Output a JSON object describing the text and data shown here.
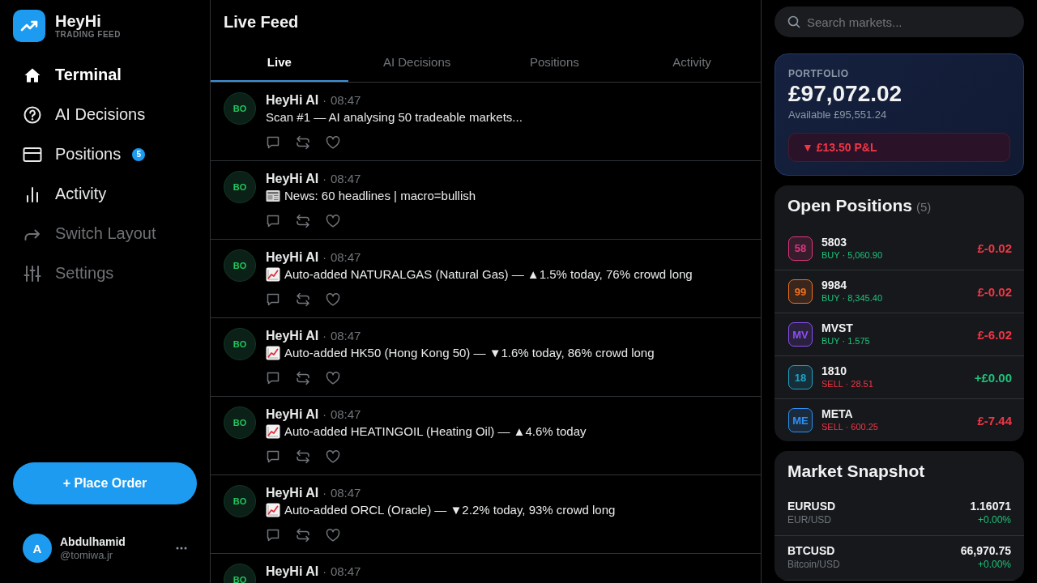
{
  "brand": {
    "name": "HeyHi",
    "tagline": "TRADING FEED"
  },
  "nav": [
    {
      "label": "Terminal",
      "selected": true,
      "disabled": false
    },
    {
      "label": "AI Decisions",
      "selected": false,
      "disabled": false
    },
    {
      "label": "Positions",
      "selected": false,
      "disabled": false,
      "badge": "5"
    },
    {
      "label": "Activity",
      "selected": false,
      "disabled": false
    },
    {
      "label": "Switch Layout",
      "selected": false,
      "disabled": true
    },
    {
      "label": "Settings",
      "selected": false,
      "disabled": true
    }
  ],
  "place_order": {
    "label": "+ Place Order"
  },
  "user": {
    "initial": "A",
    "name": "Abdulhamid",
    "handle": "@tomiwa.jr"
  },
  "feed": {
    "title": "Live Feed",
    "tabs": [
      {
        "label": "Live",
        "selected": true
      },
      {
        "label": "AI Decisions",
        "selected": false
      },
      {
        "label": "Positions",
        "selected": false
      },
      {
        "label": "Activity",
        "selected": false
      }
    ],
    "posts": [
      {
        "avatar": "BO",
        "author": "HeyHi AI",
        "separator": "·",
        "time": "08:47",
        "kind": "scan",
        "text": "Scan #1 — AI analysing 50 tradeable markets..."
      },
      {
        "avatar": "BO",
        "author": "HeyHi AI",
        "separator": "·",
        "time": "08:47",
        "kind": "news",
        "text": "News: 60 headlines | macro=bullish"
      },
      {
        "avatar": "BO",
        "author": "HeyHi AI",
        "separator": "·",
        "time": "08:47",
        "kind": "market",
        "text": "Auto-added NATURALGAS (Natural Gas) — ▲1.5% today, 76% crowd long"
      },
      {
        "avatar": "BO",
        "author": "HeyHi AI",
        "separator": "·",
        "time": "08:47",
        "kind": "market",
        "text": "Auto-added HK50 (Hong Kong 50) — ▼1.6% today, 86% crowd long"
      },
      {
        "avatar": "BO",
        "author": "HeyHi AI",
        "separator": "·",
        "time": "08:47",
        "kind": "market",
        "text": "Auto-added HEATINGOIL (Heating Oil) — ▲4.6% today"
      },
      {
        "avatar": "BO",
        "author": "HeyHi AI",
        "separator": "·",
        "time": "08:47",
        "kind": "market",
        "text": "Auto-added ORCL (Oracle) — ▼2.2% today, 93% crowd long"
      },
      {
        "avatar": "BO",
        "author": "HeyHi AI",
        "separator": "·",
        "time": "08:47"
      }
    ]
  },
  "search": {
    "placeholder": "Search markets..."
  },
  "portfolio": {
    "label": "PORTFOLIO",
    "value": "£97,072.02",
    "available": "Available £95,551.24",
    "pnl": {
      "text": "▼ £13.50 P&L",
      "loss": true
    }
  },
  "positions": {
    "title": "Open Positions",
    "count": "(5)",
    "rows": [
      {
        "badge": "58",
        "color": "#e0357f",
        "symbol": "5803",
        "detail": "BUY · 5,060.90",
        "sell": false,
        "pnl": "£-0.02",
        "loss": true
      },
      {
        "badge": "99",
        "color": "#f2711c",
        "symbol": "9984",
        "detail": "BUY · 8,345.40",
        "sell": false,
        "pnl": "£-0.02",
        "loss": true
      },
      {
        "badge": "MV",
        "color": "#8b4ff0",
        "symbol": "MVST",
        "detail": "BUY · 1.575",
        "sell": false,
        "pnl": "£-6.02",
        "loss": true
      },
      {
        "badge": "18",
        "color": "#1fa3c8",
        "symbol": "1810",
        "detail": "SELL · 28.51",
        "sell": true,
        "pnl": "+£0.00",
        "loss": false
      },
      {
        "badge": "ME",
        "color": "#2f8ff0",
        "symbol": "META",
        "detail": "SELL · 600.25",
        "sell": true,
        "pnl": "£-7.44",
        "loss": true
      }
    ]
  },
  "market": {
    "title": "Market Snapshot",
    "rows": [
      {
        "symbol": "EURUSD",
        "name": "EUR/USD",
        "price": "1.16071",
        "change": "+0.00%",
        "loss": false
      },
      {
        "symbol": "BTCUSD",
        "name": "Bitcoin/USD",
        "price": "66,970.75",
        "change": "+0.00%",
        "loss": false
      }
    ]
  }
}
